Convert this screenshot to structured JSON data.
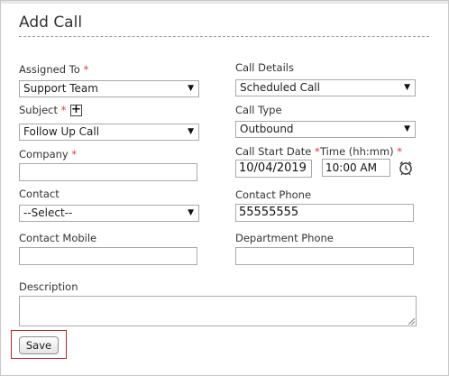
{
  "dialog": {
    "title": "Add Call"
  },
  "fields": {
    "assigned_to": {
      "label": "Assigned To",
      "required": "*",
      "value": "Support Team"
    },
    "call_details": {
      "label": "Call Details",
      "value": "Scheduled Call"
    },
    "subject": {
      "label": "Subject",
      "required": "*",
      "add_symbol": "+",
      "value": "Follow Up Call"
    },
    "call_type": {
      "label": "Call Type",
      "value": "Outbound"
    },
    "company": {
      "label": "Company",
      "required": "*",
      "value": ""
    },
    "call_start_date": {
      "label": "Call Start Date",
      "required": "*",
      "value": "10/04/2019"
    },
    "time": {
      "label": "Time (hh:mm)",
      "required": "*",
      "value": "10:00 AM"
    },
    "contact": {
      "label": "Contact",
      "value": "--Select--"
    },
    "contact_phone": {
      "label": "Contact Phone",
      "value": "55555555"
    },
    "contact_mobile": {
      "label": "Contact Mobile",
      "value": ""
    },
    "department_phone": {
      "label": "Department Phone",
      "value": ""
    },
    "description": {
      "label": "Description",
      "value": ""
    }
  },
  "icons": {
    "dropdown_arrow": "▼",
    "clock": "alarm-clock-icon"
  },
  "actions": {
    "save_label": "Save"
  },
  "colors": {
    "required": "#e0343a",
    "highlight": "#b8222b"
  }
}
